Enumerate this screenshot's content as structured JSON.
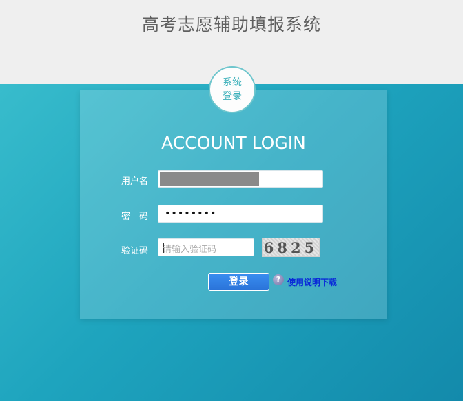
{
  "header": {
    "site_title": "高考志愿辅助填报系统"
  },
  "badge": {
    "line1": "系统",
    "line2": "登录"
  },
  "login": {
    "title": "ACCOUNT LOGIN",
    "username_label": "用户名",
    "password_label": "密　码",
    "password_value": "••••••••",
    "captcha_label": "验证码",
    "captcha_placeholder": "请输入验证码",
    "captcha_code": "6825",
    "submit_label": "登录",
    "help_icon_glyph": "?",
    "help_link": "使用说明下载"
  },
  "colors": {
    "background_teal": "#1ea4be",
    "button_blue": "#2a73d9",
    "link_blue": "#0a2bd8",
    "badge_text": "#3bb0ba"
  },
  "icons": {
    "help": "question-mark-icon"
  }
}
